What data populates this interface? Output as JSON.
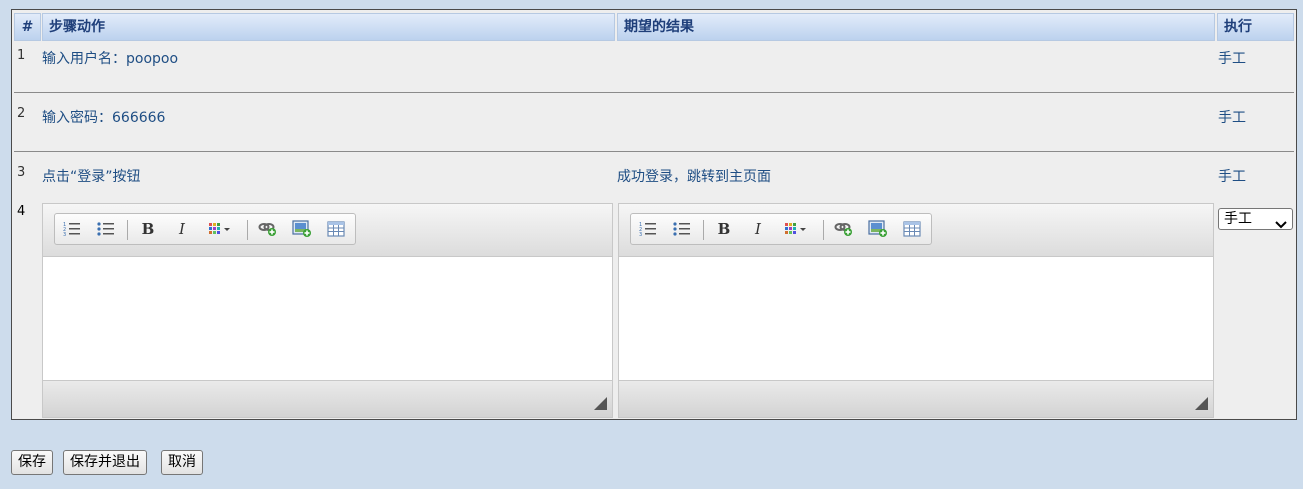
{
  "table": {
    "headers": {
      "num": "#",
      "step": "步骤动作",
      "expect": "期望的结果",
      "exec": "执行"
    },
    "rows": [
      {
        "num": "1",
        "step": "输入用户名：poopoo",
        "expect": "",
        "exec": "手工"
      },
      {
        "num": "2",
        "step": "输入密码：666666",
        "expect": "",
        "exec": "手工"
      },
      {
        "num": "3",
        "step": "点击“登录”按钮",
        "expect": "成功登录，跳转到主页面",
        "exec": "手工"
      }
    ],
    "new_row": {
      "num": "4",
      "exec_selected": "手工"
    }
  },
  "editor_toolbar": {
    "icons": [
      "ordered-list-icon",
      "unordered-list-icon",
      "bold-icon",
      "italic-icon",
      "color-grid-icon",
      "link-icon",
      "image-icon",
      "table-icon"
    ],
    "bold_glyph": "B",
    "italic_glyph": "I"
  },
  "actions": {
    "save": "保存",
    "save_exit": "保存并退出",
    "cancel": "取消"
  },
  "colors": {
    "page_bg": "#cddcec",
    "panel_bg": "#eeeeee",
    "header_text": "#1f3f7a",
    "link_text": "#1f4e84"
  }
}
